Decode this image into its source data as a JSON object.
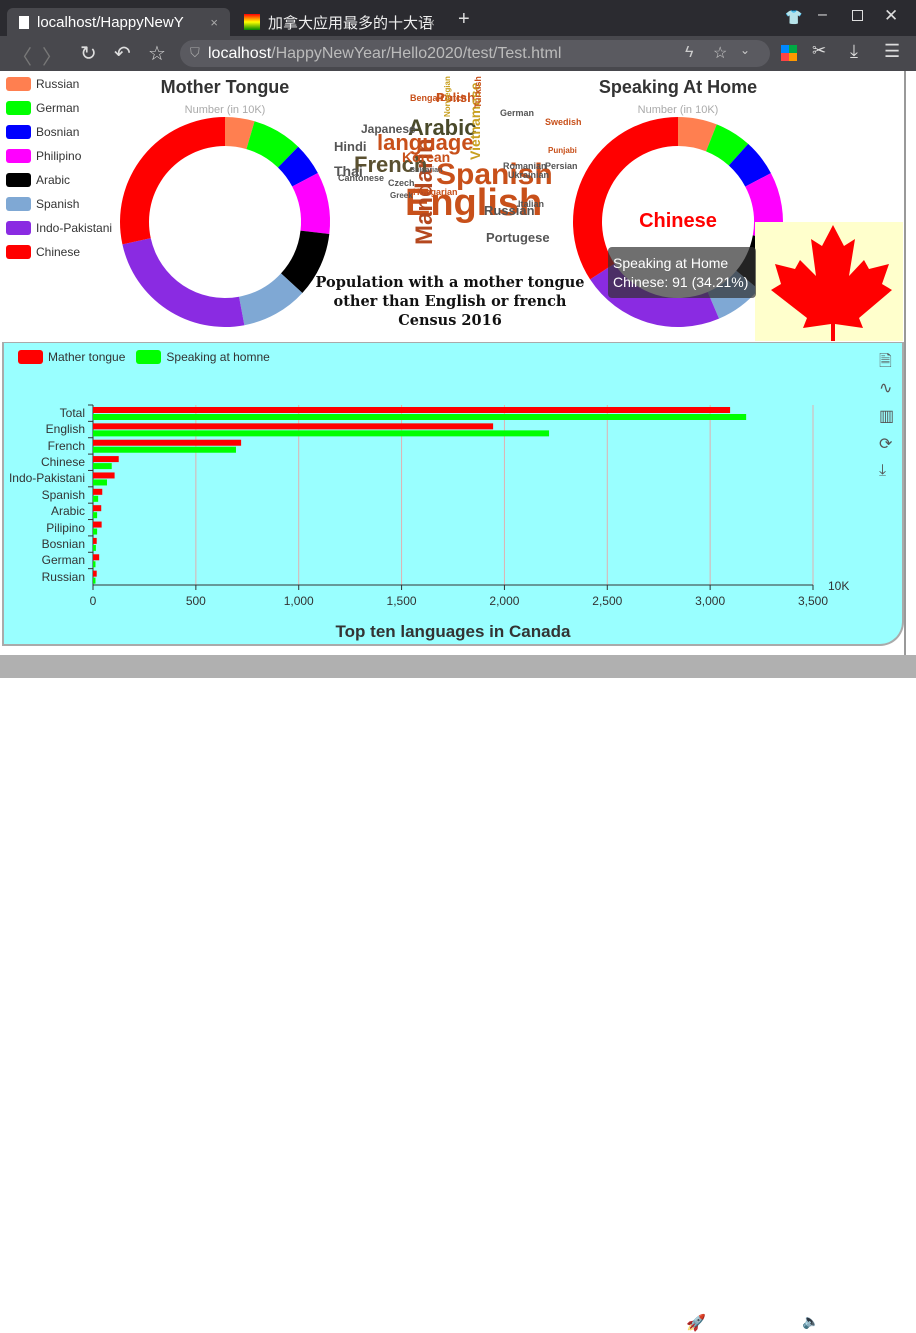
{
  "browser": {
    "tabs": [
      {
        "label": "localhost/HappyNewY",
        "close": "×"
      },
      {
        "label": "加拿大应用最多的十大语",
        "close": "×"
      }
    ],
    "new_tab": "+",
    "url_host": "localhost",
    "url_path": "/HappyNewYear/Hello2020/test/Test.html"
  },
  "legend": {
    "items": [
      {
        "label": "Russian",
        "color": "#ff7f50"
      },
      {
        "label": "German",
        "color": "#00ff00"
      },
      {
        "label": "Bosnian",
        "color": "#0000ff"
      },
      {
        "label": "Philipino",
        "color": "#ff00ff"
      },
      {
        "label": "Arabic",
        "color": "#000000"
      },
      {
        "label": "Spanish",
        "color": "#7fa8d4"
      },
      {
        "label": "Indo-Pakistani",
        "color": "#8a2be2"
      },
      {
        "label": "Chinese",
        "color": "#ff0000"
      }
    ]
  },
  "chart_data": [
    {
      "type": "pie",
      "title": "Mother Tongue",
      "subtitle": "Number (in 10K)",
      "donut": true,
      "categories": [
        "Russian",
        "German",
        "Bosnian",
        "Philipino",
        "Arabic",
        "Spanish",
        "Indo-Pakistani",
        "Chinese"
      ],
      "values": [
        20,
        34,
        22,
        42,
        44,
        45,
        108,
        125
      ]
    },
    {
      "type": "pie",
      "title": "Speaking At Home",
      "subtitle": "Number (in 10K)",
      "donut": true,
      "center_label": "Chinese",
      "categories": [
        "Russian",
        "German",
        "Bosnian",
        "Philipino",
        "Arabic",
        "Spanish",
        "Indo-Pakistani",
        "Chinese"
      ],
      "values": [
        16,
        15,
        15,
        28,
        22,
        20,
        59,
        91
      ],
      "tooltip": {
        "title": "Speaking at Home",
        "text": "Chinese: 91 (34.21%)"
      }
    },
    {
      "type": "bar",
      "orientation": "horizontal",
      "title": "Top ten languages in Canada",
      "xunit": "10K",
      "xlim": [
        0,
        3500
      ],
      "xticks": [
        "0",
        "500",
        "1,000",
        "1,500",
        "2,000",
        "2,500",
        "3,000",
        "3,500"
      ],
      "grid": true,
      "legend_position": "top-left",
      "categories": [
        "Total",
        "English",
        "French",
        "Chinese",
        "Indo-Pakistani",
        "Spanish",
        "Arabic",
        "Pilipino",
        "Bosnian",
        "German",
        "Russian"
      ],
      "series": [
        {
          "name": "Mather tongue",
          "color": "#ff0000",
          "values": [
            3097,
            1945,
            720,
            125,
            105,
            45,
            40,
            42,
            18,
            30,
            18
          ]
        },
        {
          "name": "Speaking at homne",
          "color": "#00ff00",
          "values": [
            3175,
            2217,
            695,
            91,
            68,
            25,
            20,
            20,
            14,
            12,
            12
          ]
        }
      ]
    }
  ],
  "cloud": {
    "words": [
      "English",
      "Spanish",
      "Mandarin",
      "French",
      "language",
      "Arabic",
      "Korean",
      "Portugese",
      "Russian",
      "Italian",
      "Polish",
      "Vietnamese",
      "German",
      "Japanese",
      "Hindi",
      "Thai",
      "Cantonese",
      "Czech",
      "Greek",
      "Hungarian",
      "Romanian",
      "Ukrainian",
      "Persian",
      "Bengali",
      "Dutch",
      "Turkish",
      "Swedish",
      "Punjabi",
      "Norwegian",
      "Bulgarian"
    ]
  },
  "poster": {
    "lines": [
      "Population with a mother tongue",
      "other than English or french",
      "Census 2016"
    ]
  },
  "toolbox": [
    "data-view-icon",
    "line-chart-icon",
    "bar-chart-icon",
    "restore-icon",
    "save-image-icon"
  ]
}
